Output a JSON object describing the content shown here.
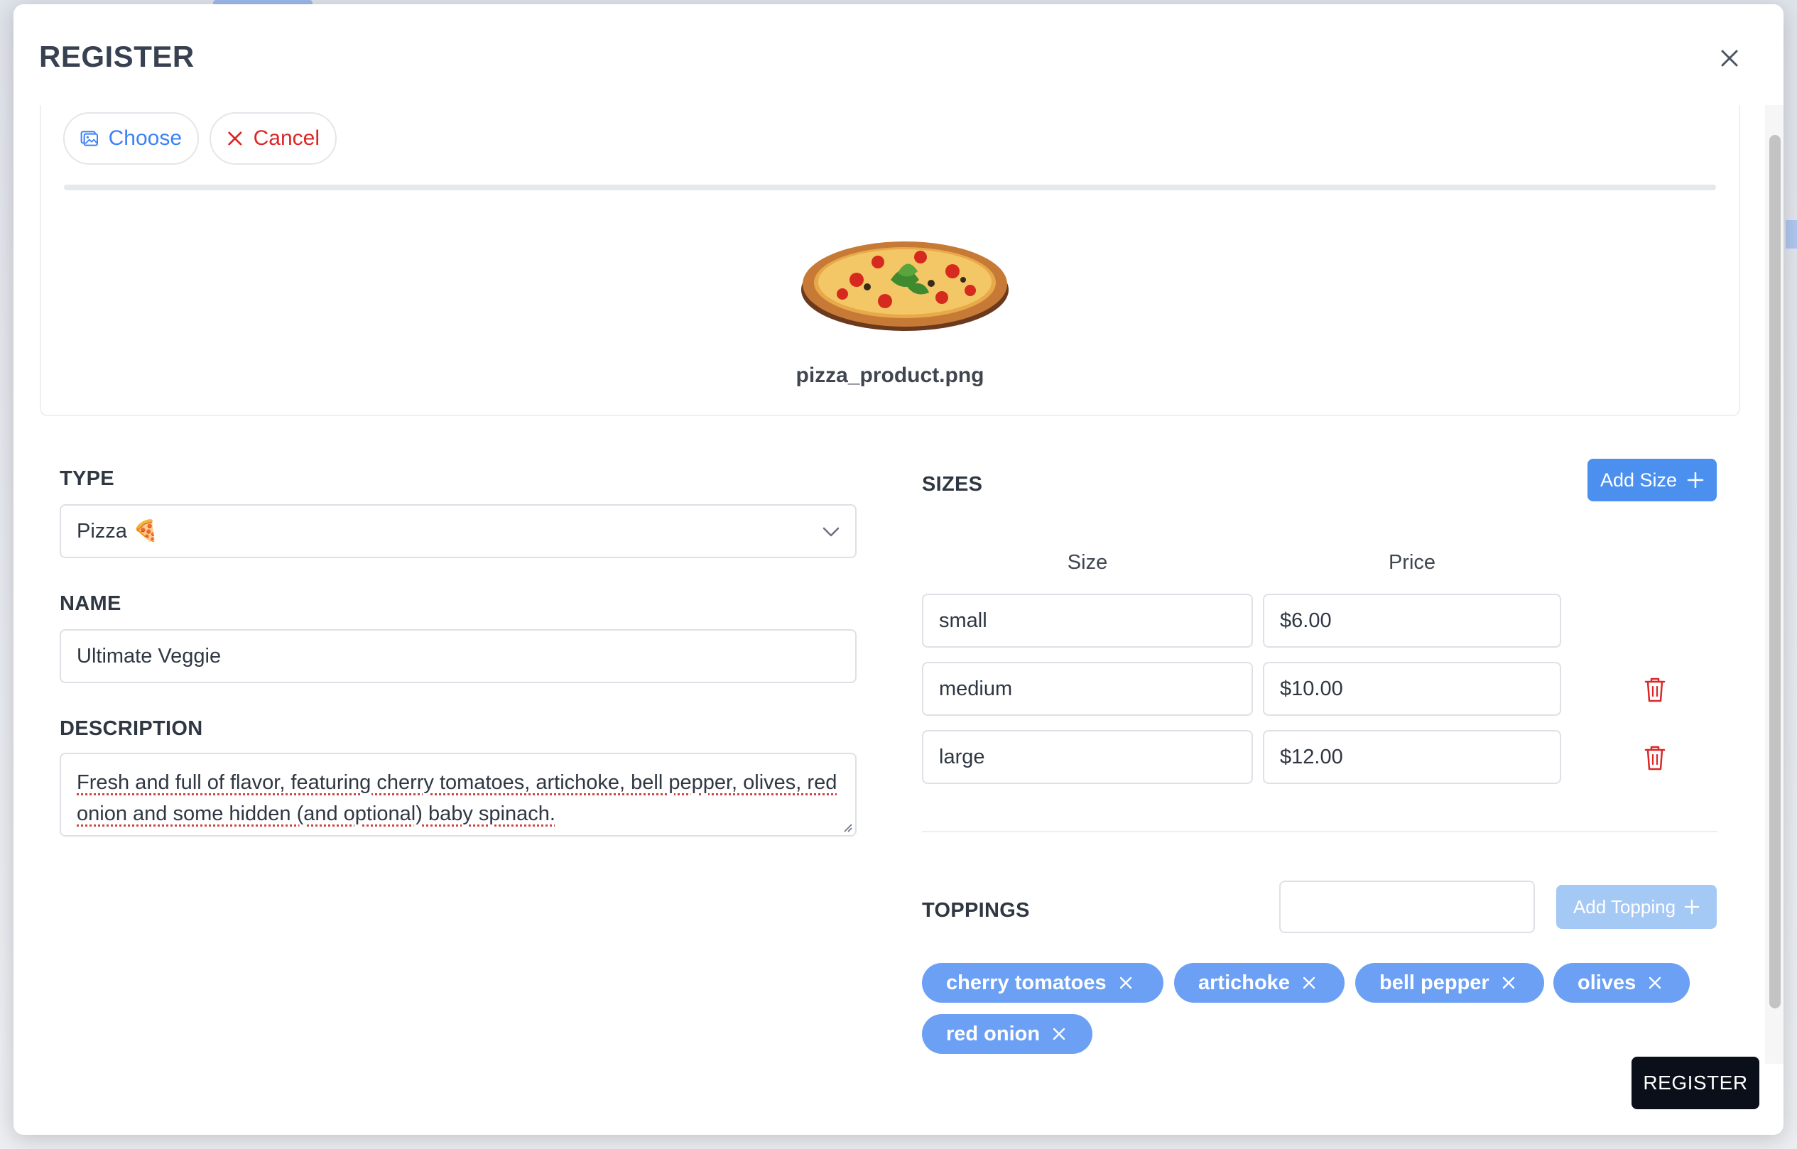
{
  "modal": {
    "title": "REGISTER",
    "close_icon": "close-icon"
  },
  "upload": {
    "choose_label": "Choose",
    "cancel_label": "Cancel",
    "progress": 0,
    "file_name": "pizza_product.png"
  },
  "form": {
    "type_label": "TYPE",
    "type_value": "Pizza 🍕",
    "name_label": "NAME",
    "name_value": "Ultimate Veggie",
    "description_label": "DESCRIPTION",
    "description_value": "Fresh and full of flavor, featuring cherry tomatoes, artichoke, bell pepper, olives, red onion and some hidden (and optional) baby spinach."
  },
  "sizes": {
    "title": "SIZES",
    "add_label": "Add Size",
    "size_header": "Size",
    "price_header": "Price",
    "rows": [
      {
        "size": "small",
        "price": "$6.00"
      },
      {
        "size": "medium",
        "price": "$10.00"
      },
      {
        "size": "large",
        "price": "$12.00"
      }
    ]
  },
  "toppings": {
    "title": "TOPPINGS",
    "input_value": "",
    "add_label": "Add Topping",
    "items": [
      "cherry tomatoes",
      "artichoke",
      "bell pepper",
      "olives",
      "red onion"
    ]
  },
  "footer": {
    "register_label": "REGISTER"
  },
  "colors": {
    "primary": "#4b90ef",
    "chip": "#6ca0f4",
    "danger": "#dc2626",
    "dark": "#0b0f19"
  }
}
